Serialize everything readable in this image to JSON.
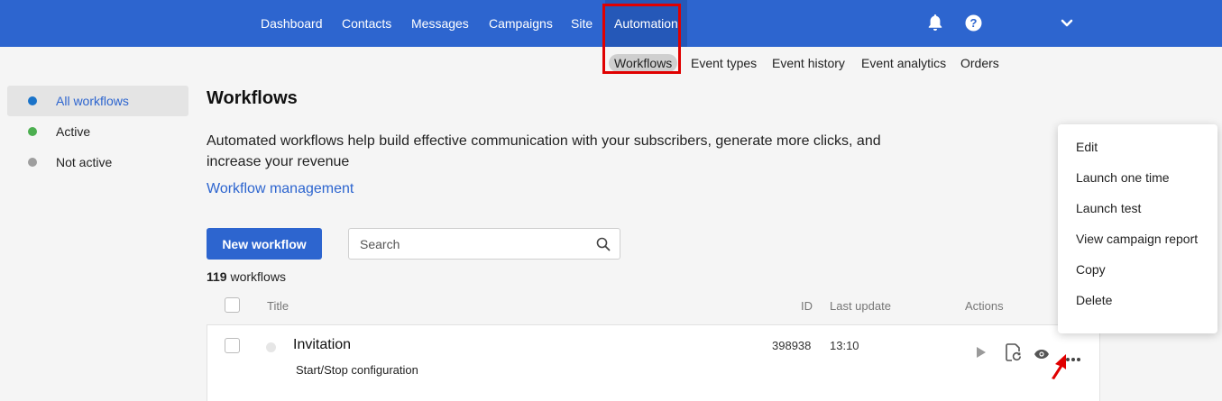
{
  "nav": {
    "items": [
      "Dashboard",
      "Contacts",
      "Messages",
      "Campaigns",
      "Site",
      "Automation"
    ],
    "active": "Automation"
  },
  "subnav": {
    "items": [
      "Workflows",
      "Event types",
      "Event history",
      "Event analytics",
      "Orders"
    ],
    "active": "Workflows"
  },
  "sidebar": {
    "items": [
      {
        "label": "All workflows",
        "dot_color": "#1a73c9"
      },
      {
        "label": "Active",
        "dot_color": "#4caf50"
      },
      {
        "label": "Not active",
        "dot_color": "#9e9e9e"
      }
    ]
  },
  "main": {
    "title": "Workflows",
    "description": "Automated workflows help build effective communication with your subscribers, generate more clicks, and increase your revenue",
    "link": "Workflow management",
    "new_button": "New workflow",
    "search_placeholder": "Search",
    "count_number": "119",
    "count_label": "workflows"
  },
  "table": {
    "headers": {
      "title": "Title",
      "id": "ID",
      "last_update": "Last update",
      "actions": "Actions"
    },
    "rows": [
      {
        "title": "Invitation",
        "subtitle": "Start/Stop configuration",
        "id": "398938",
        "last_update": "13:10"
      }
    ]
  },
  "menu": {
    "items": [
      "Edit",
      "Launch one time",
      "Launch test",
      "View campaign report",
      "Copy",
      "Delete"
    ],
    "highlighted": "Copy"
  },
  "colors": {
    "brand": "#2d65cf",
    "highlight": "#e00000"
  },
  "icons": [
    "bell-icon",
    "help-icon",
    "chevron-down-icon",
    "search-icon",
    "play-icon",
    "document-refresh-icon",
    "eye-icon",
    "more-dots-icon",
    "cursor-arrow-icon"
  ]
}
